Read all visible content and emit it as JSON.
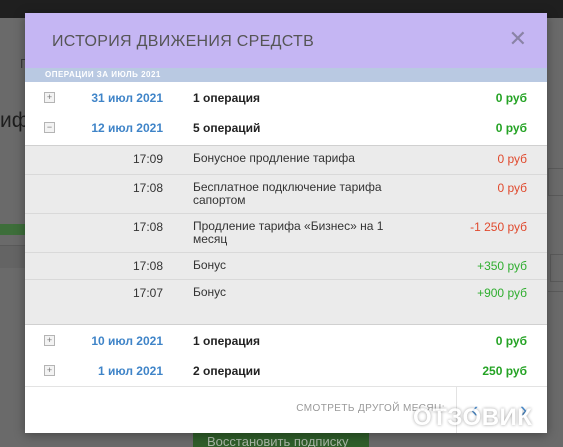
{
  "background": {
    "text_a": "П",
    "text_b": "иф",
    "button_label": "Восстановить подписку"
  },
  "modal": {
    "title": "ИСТОРИЯ ДВИЖЕНИЯ СРЕДСТВ",
    "close_icon": "close-icon",
    "period_label": "ОПЕРАЦИИ ЗА ИЮЛЬ 2021",
    "days": [
      {
        "toggle": "+",
        "date": "31 июл 2021",
        "count": "1 операция",
        "amount": "0 руб"
      },
      {
        "toggle": "−",
        "date": "12 июл 2021",
        "count": "5 операций",
        "amount": "0 руб"
      },
      {
        "toggle": "+",
        "date": "10 июл 2021",
        "count": "1 операция",
        "amount": "0 руб"
      },
      {
        "toggle": "+",
        "date": "1 июл 2021",
        "count": "2 операции",
        "amount": "250 руб"
      }
    ],
    "details": [
      {
        "time": "17:09",
        "desc": "Бонусное продление тарифа",
        "amount": "0 руб",
        "color": "#e04a2e"
      },
      {
        "time": "17:08",
        "desc": "Бесплатное подключение тарифа сапортом",
        "amount": "0 руб",
        "color": "#e04a2e"
      },
      {
        "time": "17:08",
        "desc": "Продление тарифа «Бизнес» на 1 месяц",
        "amount": "-1 250 руб",
        "color": "#e04a2e"
      },
      {
        "time": "17:08",
        "desc": "Бонус",
        "amount": "+350 руб",
        "color": "#2fae2f"
      },
      {
        "time": "17:07",
        "desc": "Бонус",
        "amount": "+900 руб",
        "color": "#2fae2f"
      }
    ],
    "other_month_label": "СМОТРЕТЬ ДРУГОЙ МЕСЯЦ:",
    "prev_icon": "chevron-left-icon",
    "next_icon": "chevron-right-icon"
  },
  "watermark": "ОТЗОВИК",
  "colors": {
    "header_bg": "#c5b6f3",
    "period_bg": "#b9c9e2",
    "date_link": "#3f84c8",
    "positive": "#25a325",
    "negative": "#e04a2e"
  }
}
